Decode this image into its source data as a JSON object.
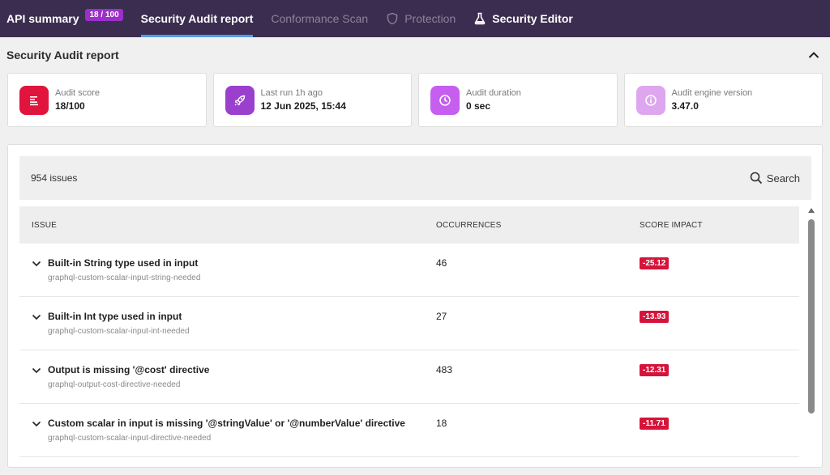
{
  "nav": {
    "tabs": [
      {
        "label": "API summary",
        "badge": "18 / 100"
      },
      {
        "label": "Security Audit report"
      },
      {
        "label": "Conformance Scan"
      },
      {
        "label": "Protection"
      },
      {
        "label": "Security Editor"
      }
    ]
  },
  "section": {
    "title": "Security Audit report"
  },
  "cards": [
    {
      "label": "Audit score",
      "value": "18/100",
      "icon": "list-icon",
      "color": "#e0143c"
    },
    {
      "label": "Last run 1h ago",
      "value": "12 Jun 2025, 15:44",
      "icon": "rocket-icon",
      "color": "#9b3fcf"
    },
    {
      "label": "Audit duration",
      "value": "0 sec",
      "icon": "clock-icon",
      "color": "#c65ef0"
    },
    {
      "label": "Audit engine version",
      "value": "3.47.0",
      "icon": "info-icon",
      "color": "#dda6ee"
    }
  ],
  "issues": {
    "count_label": "954 issues",
    "search_label": "Search",
    "headers": {
      "issue": "ISSUE",
      "occurrences": "OCCURRENCES",
      "score_impact": "SCORE IMPACT"
    },
    "rows": [
      {
        "title": "Built-in String type used in input",
        "id": "graphql-custom-scalar-input-string-needed",
        "occurrences": "46",
        "impact": "-25.12"
      },
      {
        "title": "Built-in Int type used in input",
        "id": "graphql-custom-scalar-input-int-needed",
        "occurrences": "27",
        "impact": "-13.93"
      },
      {
        "title": "Output is missing '@cost' directive",
        "id": "graphql-output-cost-directive-needed",
        "occurrences": "483",
        "impact": "-12.31"
      },
      {
        "title": "Custom scalar in input is missing '@stringValue' or '@numberValue' directive",
        "id": "graphql-custom-scalar-input-directive-needed",
        "occurrences": "18",
        "impact": "-11.71"
      }
    ]
  },
  "colors": {
    "topbar": "#3b2d4f",
    "active_underline": "#4f9ee8",
    "badge": "#9b30c9",
    "impact": "#d6133a"
  }
}
